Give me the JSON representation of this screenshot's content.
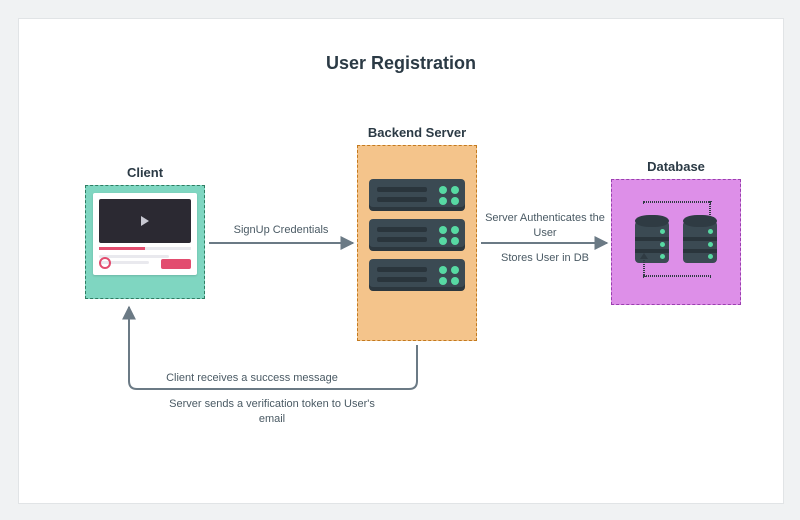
{
  "title": "User Registration",
  "nodes": {
    "client": {
      "label": "Client"
    },
    "server": {
      "label": "Backend Server"
    },
    "database": {
      "label": "Database"
    }
  },
  "edges": {
    "signup": "SignUp Credentials",
    "auth": "Server Authenticates the User",
    "store": "Stores User in DB",
    "success": "Client receives a success message",
    "verify": "Server sends a verification token to User's email"
  },
  "colors": {
    "client_fill": "#7fd6c1",
    "server_fill": "#f4c48b",
    "database_fill": "#dd8fe8",
    "arrow": "#6b7a85"
  }
}
